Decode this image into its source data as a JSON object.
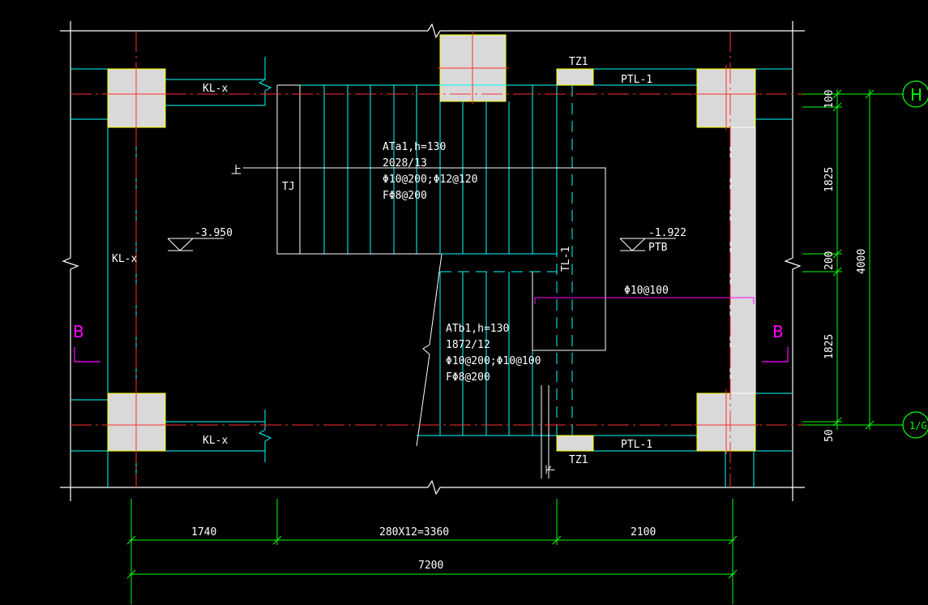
{
  "stair_upper": {
    "code": "ATa1,h=130",
    "steps": "2028/13",
    "rebar": "Φ10@200;Φ12@120",
    "dist": "FΦ8@200"
  },
  "stair_lower": {
    "code": "ATb1,h=130",
    "steps": "1872/12",
    "rebar": "Φ10@200;Φ10@100",
    "dist": "FΦ8@200"
  },
  "labels": {
    "kl_top": "KL-x",
    "kl_left": "KL-x",
    "kl_bottom": "KL-x",
    "tz_top": "TZ1",
    "tz_bottom": "TZ1",
    "ptl_top": "PTL-1",
    "ptl_bottom": "PTL-1",
    "tl": "TL-1",
    "tj": "TJ",
    "up": "上",
    "wall_rebar": "Φ10@100",
    "down_mark": "下"
  },
  "elevations": {
    "left": "-3.950",
    "right": "-1.922",
    "right_note": "PTB"
  },
  "section_marks": {
    "left": "B",
    "right": "B"
  },
  "grid_axes": {
    "top": "H",
    "bottom": "1/G"
  },
  "dimensions": {
    "bottom_1": "1740",
    "bottom_2": "280X12=3360",
    "bottom_3": "2100",
    "bottom_total": "7200",
    "right_1": "100",
    "right_2": "1825",
    "right_3": "200",
    "right_4": "1825",
    "right_5": "50",
    "right_total": "4000"
  },
  "colors": {
    "background": "#000000",
    "outline": "#ffffff",
    "stair": "#00ffff",
    "axis": "#ff0000",
    "dimension": "#00ff00",
    "column_fill": "#d9d9d9",
    "column_edge": "#ffff00",
    "section": "#ff00ff"
  }
}
